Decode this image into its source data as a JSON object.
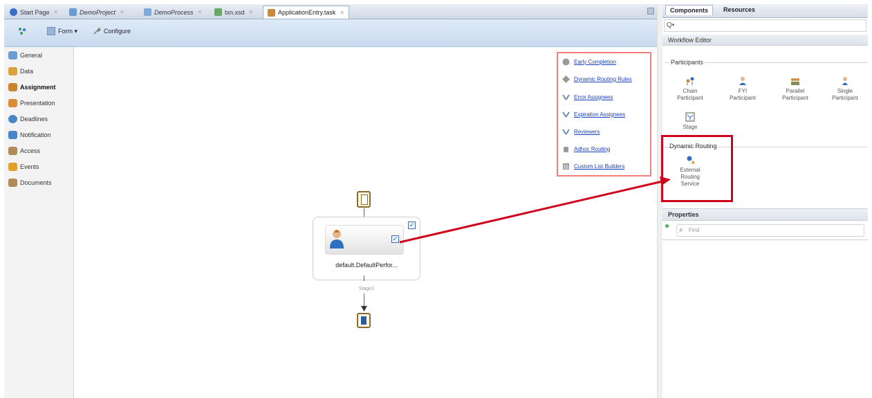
{
  "tabs": [
    {
      "label": "Start Page",
      "italic": false,
      "active": false,
      "color": "#3a6fc4"
    },
    {
      "label": "DemoProject",
      "italic": true,
      "active": false,
      "color": "#6b9bd2"
    },
    {
      "label": "DemoProcess",
      "italic": true,
      "active": false,
      "color": "#7fa9d9"
    },
    {
      "label": "txn.xsd",
      "italic": false,
      "active": false,
      "color": "#6aa86a"
    },
    {
      "label": "ApplicationEntry.task",
      "italic": false,
      "active": true,
      "color": "#c98a3a"
    }
  ],
  "toolbar": {
    "form_label": "Form ▾",
    "configure_label": "Configure"
  },
  "leftnav": [
    {
      "label": "General",
      "selected": false,
      "color": "#6a9bd1"
    },
    {
      "label": "Data",
      "selected": false,
      "color": "#d9a23a"
    },
    {
      "label": "Assignment",
      "selected": true,
      "color": "#c9852e"
    },
    {
      "label": "Presentation",
      "selected": false,
      "color": "#d98b3a"
    },
    {
      "label": "Deadlines",
      "selected": false,
      "color": "#4a86c5"
    },
    {
      "label": "Notification",
      "selected": false,
      "color": "#4a86c5"
    },
    {
      "label": "Access",
      "selected": false,
      "color": "#b08a5a"
    },
    {
      "label": "Events",
      "selected": false,
      "color": "#e0a02a"
    },
    {
      "label": "Documents",
      "selected": false,
      "color": "#b08a5a"
    }
  ],
  "legend": [
    {
      "label": "Early Completion",
      "icon": "circle-icon"
    },
    {
      "label": "Dynamic Routing Rules",
      "icon": "diamond-icon"
    },
    {
      "label": "Error Assignees",
      "icon": "assignees-icon"
    },
    {
      "label": "Expiration Assignees",
      "icon": "assignees-icon"
    },
    {
      "label": "Reviewers",
      "icon": "assignees-icon"
    },
    {
      "label": "Adhoc Routing",
      "icon": "adhoc-icon"
    },
    {
      "label": "Custom List Builders",
      "icon": "list-icon"
    }
  ],
  "diagram": {
    "participant_label": "default.DefaultPerfor...",
    "stage_label": "Stage1"
  },
  "right_panel": {
    "tabs": [
      "Components",
      "Resources"
    ],
    "search_prefix": "Q•",
    "section_title": "Workflow Editor",
    "participants_title": "Participants",
    "participants": [
      {
        "line1": "Chain",
        "line2": "Participant"
      },
      {
        "line1": "FYI",
        "line2": "Participant"
      },
      {
        "line1": "Parallel",
        "line2": "Participant"
      },
      {
        "line1": "Single",
        "line2": "Participant"
      }
    ],
    "stage_label": "Stage",
    "dynamic_title": "Dynamic Routing",
    "dynamic_item": {
      "line1": "External",
      "line2": "Routing",
      "line3": "Service"
    },
    "properties_title": "Properties",
    "find_placeholder": "Find"
  },
  "colors": {
    "highlight": "#d0021b",
    "legend_border": "#f08080",
    "link": "#1a3fbf"
  }
}
